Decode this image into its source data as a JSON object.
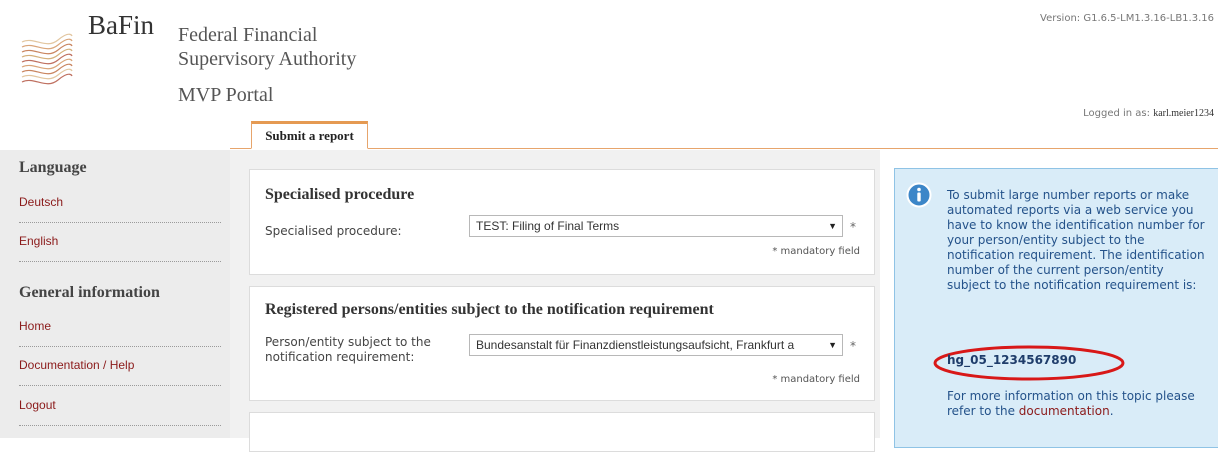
{
  "header": {
    "brand": "BaFin",
    "org_line1": "Federal Financial",
    "org_line2": "Supervisory Authority",
    "portal": "MVP Portal",
    "version": "Version: G1.6.5-LM1.3.16-LB1.3.16",
    "logged_in_label": "Logged in as:",
    "username": "karl.meier1234"
  },
  "tabs": [
    {
      "label": "Submit a report",
      "active": true
    }
  ],
  "sidebar": {
    "sections": [
      {
        "heading": "Language",
        "items": [
          {
            "label": "Deutsch"
          },
          {
            "label": "English"
          }
        ]
      },
      {
        "heading": "General information",
        "items": [
          {
            "label": "Home"
          },
          {
            "label": "Documentation / Help"
          },
          {
            "label": "Logout"
          }
        ]
      }
    ]
  },
  "main": {
    "panels": [
      {
        "heading": "Specialised procedure",
        "field_label": "Specialised procedure:",
        "value": "TEST: Filing of Final Terms",
        "required_marker": "*",
        "mandatory_note": "* mandatory field"
      },
      {
        "heading": "Registered persons/entities subject to the notification requirement",
        "field_label_1": "Person/entity subject to the",
        "field_label_2": "notification requirement:",
        "value": "Bundesanstalt für Finanzdienstleistungsaufsicht, Frankfurt a",
        "required_marker": "*",
        "mandatory_note": "* mandatory field"
      }
    ]
  },
  "info": {
    "text": "To submit large number reports or make automated reports via a web service you have to know the identification number for your person/entity subject to the notification requirement. The identification number of the current person/entity subject to the notification requirement is:",
    "id": "hg_05_1234567890",
    "more_prefix": "For more information on this topic please refer to the",
    "more_link": "documentation",
    "more_suffix": "."
  },
  "colors": {
    "accent_orange": "#e59a52",
    "link_red": "#8b1a1a",
    "info_bg": "#d9ecf8",
    "annotation_red": "#d81818"
  },
  "icons": [
    "bafin-logo-icon",
    "info-icon",
    "dropdown-caret-icon"
  ]
}
